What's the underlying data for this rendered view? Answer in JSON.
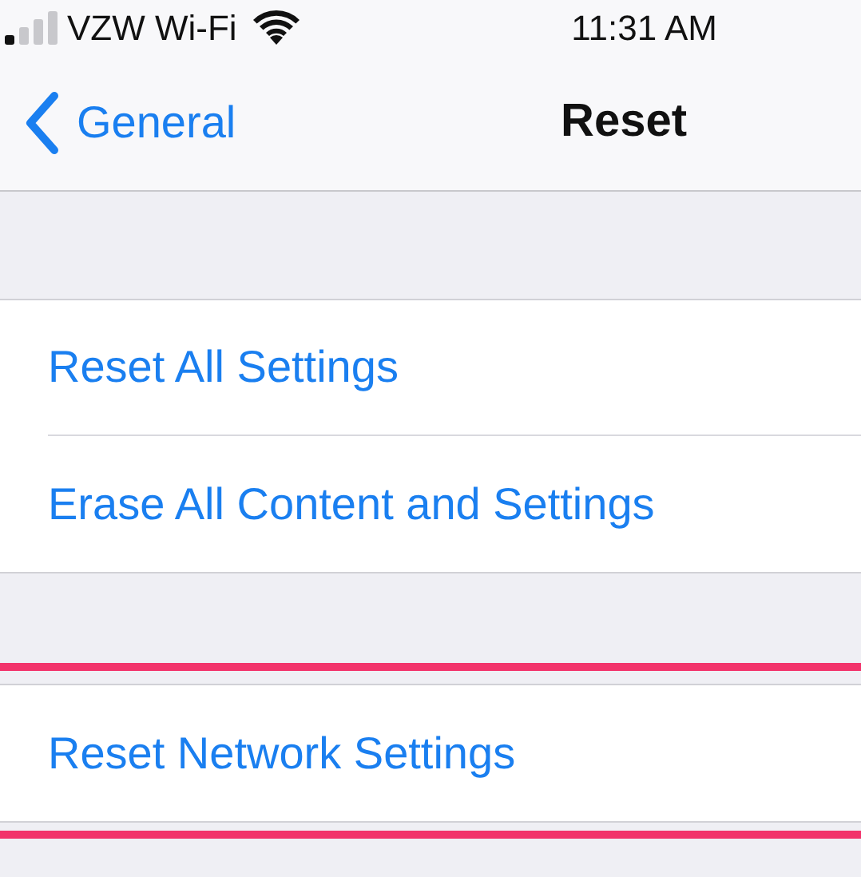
{
  "status_bar": {
    "carrier": "VZW Wi-Fi",
    "time": "11:31 AM"
  },
  "nav": {
    "back": "General",
    "title": "Reset"
  },
  "groups": [
    {
      "highlighted": false,
      "items": [
        "Reset All Settings",
        "Erase All Content and Settings"
      ]
    },
    {
      "highlighted": true,
      "items": [
        "Reset Network Settings"
      ]
    }
  ]
}
